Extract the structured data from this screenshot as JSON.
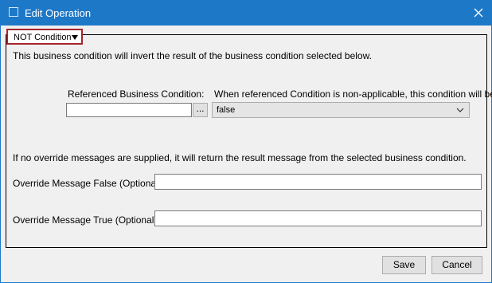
{
  "window": {
    "title": "Edit Operation"
  },
  "condition_type": {
    "selected": "NOT Condition"
  },
  "description": "This business condition will invert the result of the business condition selected below.",
  "referenced_condition": {
    "label": "Referenced Business Condition:",
    "value": "",
    "browse_label": "..."
  },
  "non_applicable": {
    "label": "When referenced Condition is non-applicable, this condition will be:",
    "selected": "false"
  },
  "override_note": "If no override messages are supplied, it will return the result message from the selected business condition.",
  "override_false": {
    "label": "Override Message False (Optional):",
    "value": ""
  },
  "override_true": {
    "label": "Override Message True (Optional):",
    "value": ""
  },
  "buttons": {
    "save": "Save",
    "cancel": "Cancel"
  },
  "colors": {
    "titlebar": "#1e78c8",
    "dropdown_border": "#a4262c"
  },
  "icons": {
    "window": "window-icon",
    "close": "close-icon",
    "dropdown": "triangle-down-icon",
    "select": "chevron-down-icon"
  }
}
